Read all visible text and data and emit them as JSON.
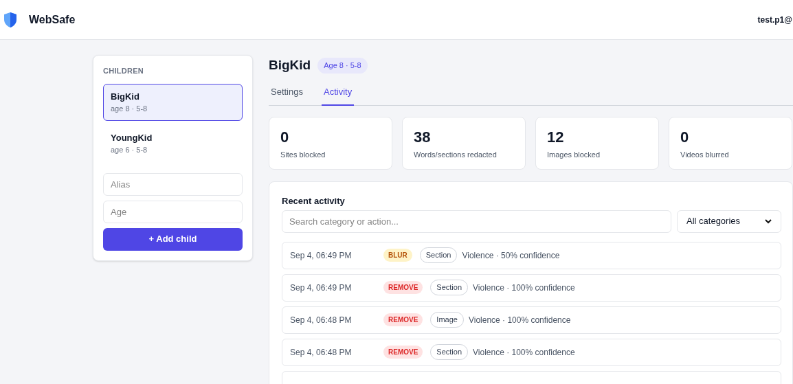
{
  "header": {
    "brand": "WebSafe",
    "user": "test.p1@"
  },
  "children_panel": {
    "title": "CHILDREN",
    "items": [
      {
        "name": "BigKid",
        "meta": "age 8 · 5-8",
        "selected": true
      },
      {
        "name": "YoungKid",
        "meta": "age 6 · 5-8",
        "selected": false
      }
    ],
    "alias_field": {
      "placeholder": "Alias"
    },
    "age_field": {
      "placeholder": "Age"
    },
    "add_button": "+ Add child"
  },
  "profile": {
    "name": "BigKid",
    "badge": "Age 8 · 5-8"
  },
  "tabs": [
    {
      "label": "Settings",
      "selected": false
    },
    {
      "label": "Activity",
      "selected": true
    }
  ],
  "stats": [
    {
      "value": "0",
      "label": "Sites blocked"
    },
    {
      "value": "38",
      "label": "Words/sections redacted"
    },
    {
      "value": "12",
      "label": "Images blocked"
    },
    {
      "value": "0",
      "label": "Videos blurred"
    }
  ],
  "activity": {
    "title": "Recent activity",
    "search": {
      "placeholder": "Search category or action..."
    },
    "filter": "All categories",
    "rows": [
      {
        "time": "Sep 4, 06:49 PM",
        "action": "BLUR",
        "kind": "blur",
        "target": "Section",
        "detail": "Violence · 50% confidence"
      },
      {
        "time": "Sep 4, 06:49 PM",
        "action": "REMOVE",
        "kind": "remove",
        "target": "Section",
        "detail": "Violence · 100% confidence"
      },
      {
        "time": "Sep 4, 06:48 PM",
        "action": "REMOVE",
        "kind": "remove",
        "target": "Image",
        "detail": "Violence · 100% confidence"
      },
      {
        "time": "Sep 4, 06:48 PM",
        "action": "REMOVE",
        "kind": "remove",
        "target": "Section",
        "detail": "Violence · 100% confidence"
      }
    ]
  }
}
